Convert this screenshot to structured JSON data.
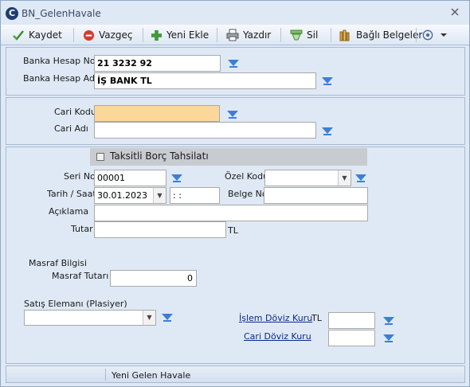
{
  "window": {
    "title": "BN_GelenHavale",
    "app_icon": "C"
  },
  "toolbar": {
    "items": [
      {
        "label": "Kaydet",
        "icon": "checkmark-icon"
      },
      {
        "label": "Vazgeç",
        "icon": "cancel-icon"
      },
      {
        "label": "Yeni Ekle",
        "icon": "plus-icon"
      },
      {
        "label": "Yazdır",
        "icon": "printer-icon"
      },
      {
        "label": "Sil",
        "icon": "eraser-icon"
      },
      {
        "label": "Bağlı Belgeler",
        "icon": "documents-icon"
      }
    ]
  },
  "bank": {
    "account_no_label": "Banka Hesap No",
    "account_no_value": "21 3232 92",
    "account_name_label": "Banka Hesap Adı",
    "account_name_value": "İŞ BANK TL"
  },
  "cari": {
    "code_label": "Cari Kodu",
    "code_value": "",
    "name_label": "Cari Adı",
    "name_value": ""
  },
  "details": {
    "installment_label": "Taksitli Borç Tahsilatı",
    "installment_checked": false,
    "serial_label": "Seri No",
    "serial_value": "00001",
    "special_code_label": "Özel Kodu",
    "special_code_value": "",
    "date_label": "Tarih / Saat",
    "date_value": "30.01.2023",
    "time_value": " :  :",
    "doc_no_label": "Belge No",
    "doc_no_value": "",
    "description_label": "Açıklama",
    "description_value": "",
    "amount_label": "Tutar",
    "amount_value": "",
    "currency": "TL",
    "expense_section_label": "Masraf Bilgisi",
    "expense_amount_label": "Masraf Tutarı",
    "expense_amount_value": "0",
    "sales_rep_label": "Satış Elemanı (Plasiyer)",
    "sales_rep_value": "",
    "transaction_rate_label": "İşlem Döviz Kuru",
    "transaction_rate_currency": "TL",
    "transaction_rate_value": "",
    "cari_rate_label": "Cari Döviz Kuru",
    "cari_rate_value": ""
  },
  "status": {
    "text": "Yeni Gelen Havale"
  },
  "colors": {
    "funnel": "#3d7fd6",
    "required_field": "#fcd79a",
    "link": "#0a2a8a"
  }
}
